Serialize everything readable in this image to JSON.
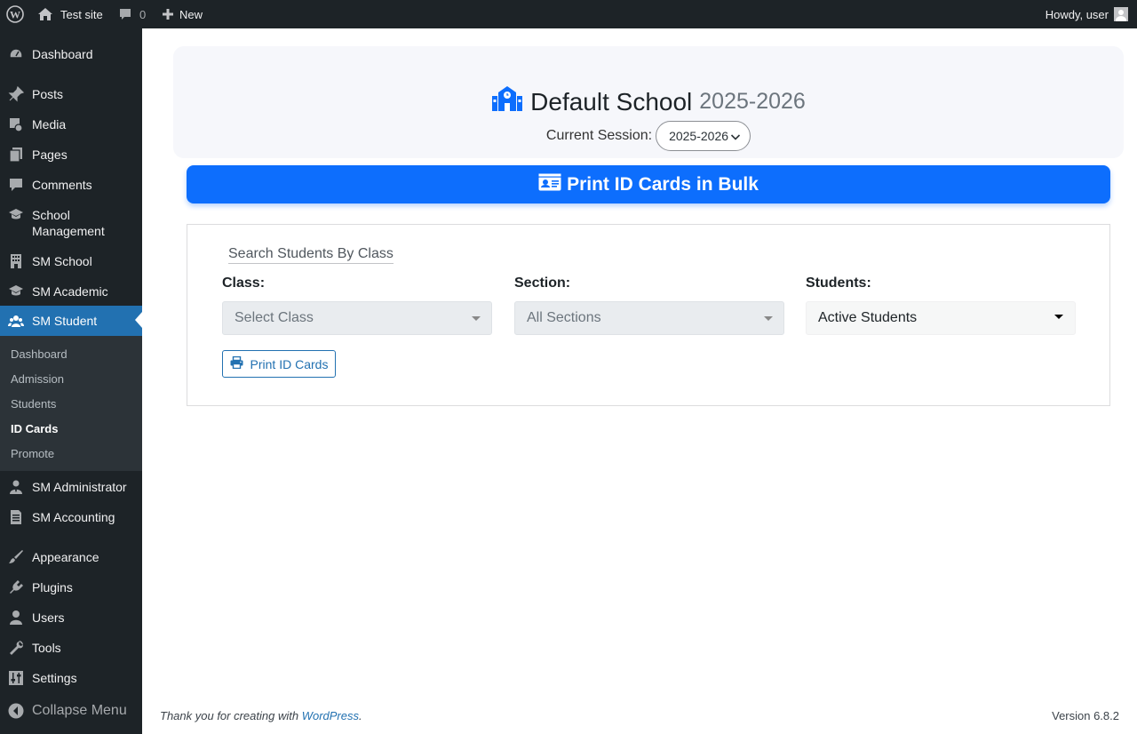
{
  "adminbar": {
    "site_name": "Test site",
    "comments_count": "0",
    "new_label": "New",
    "howdy": "Howdy, user"
  },
  "sidebar": {
    "items": [
      {
        "label": "Dashboard",
        "icon": "dashboard-icon"
      },
      {
        "label": "Posts",
        "icon": "pin-icon"
      },
      {
        "label": "Media",
        "icon": "media-icon"
      },
      {
        "label": "Pages",
        "icon": "pages-icon"
      },
      {
        "label": "Comments",
        "icon": "comment-icon"
      },
      {
        "label": "School Management",
        "icon": "graduation-cap-icon"
      },
      {
        "label": "SM School",
        "icon": "building-icon"
      },
      {
        "label": "SM Academic",
        "icon": "graduation-cap-icon"
      },
      {
        "label": "SM Student",
        "icon": "users-icon"
      },
      {
        "label": "SM Administrator",
        "icon": "admin-user-icon"
      },
      {
        "label": "SM Accounting",
        "icon": "invoice-icon"
      },
      {
        "label": "Appearance",
        "icon": "brush-icon"
      },
      {
        "label": "Plugins",
        "icon": "plugin-icon"
      },
      {
        "label": "Users",
        "icon": "user-icon"
      },
      {
        "label": "Tools",
        "icon": "wrench-icon"
      },
      {
        "label": "Settings",
        "icon": "settings-icon"
      }
    ],
    "submenu": [
      "Dashboard",
      "Admission",
      "Students",
      "ID Cards",
      "Promote"
    ],
    "collapse_label": "Collapse Menu"
  },
  "main": {
    "school_name": "Default School",
    "school_year": "2025-2026",
    "session_label": "Current Session:",
    "session_value": "2025-2026",
    "bulk_title": "Print ID Cards in Bulk",
    "search_title": "Search Students By Class",
    "class_label": "Class:",
    "class_placeholder": "Select Class",
    "section_label": "Section:",
    "section_placeholder": "All Sections",
    "students_label": "Students:",
    "students_value": "Active Students",
    "print_button": "Print ID Cards"
  },
  "footer": {
    "thanks_prefix": "Thank you for creating with",
    "wordpress_link": "WordPress",
    "thanks_suffix": ".",
    "version": "Version 6.8.2"
  },
  "colors": {
    "admin_dark": "#1d2327",
    "accent_blue": "#2271b1",
    "primary_blue": "#0d6efd"
  }
}
